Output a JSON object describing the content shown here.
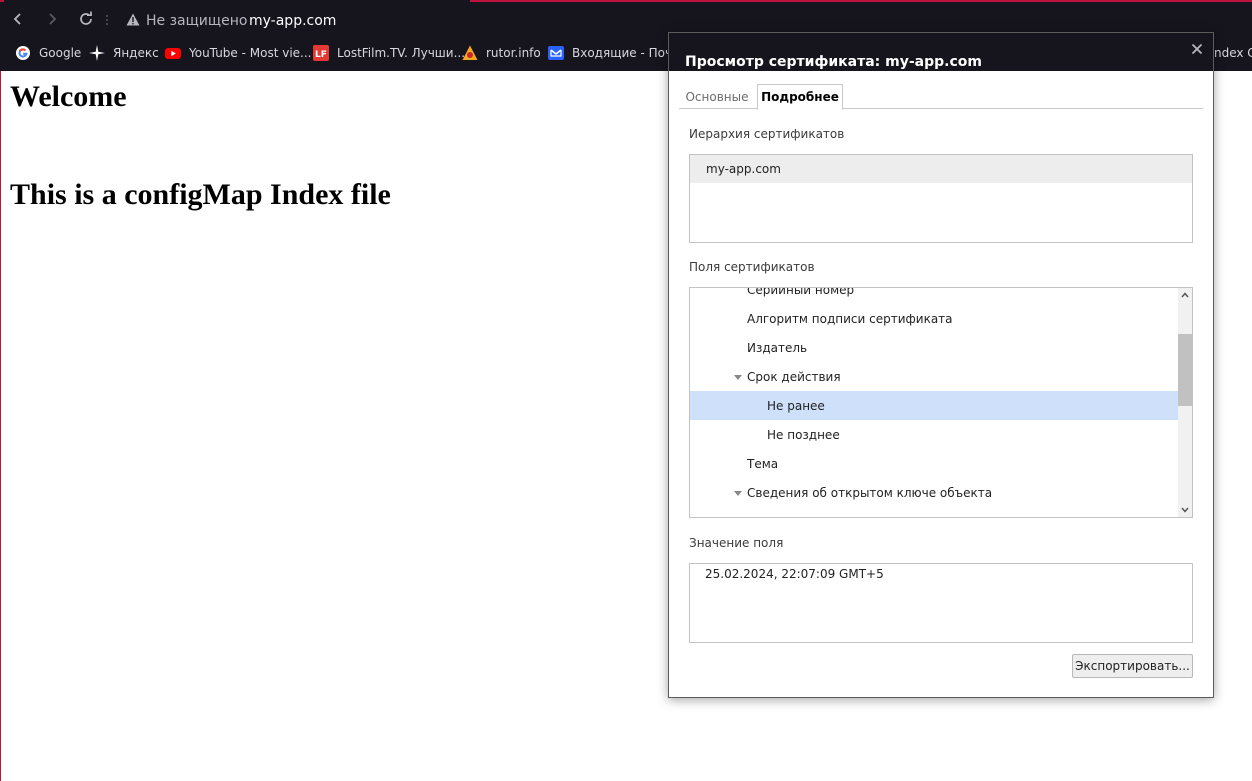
{
  "browser": {
    "security_label": "Не защищено",
    "url": "my-app.com",
    "bookmarks": [
      {
        "label": "Google",
        "icon": "google-icon"
      },
      {
        "label": "Яндекс",
        "icon": "yandex-icon"
      },
      {
        "label": "YouTube - Most vie...",
        "icon": "youtube-icon"
      },
      {
        "label": "LostFilm.TV. Лучши...",
        "icon": "lostfilm-icon"
      },
      {
        "label": "rutor.info",
        "icon": "rutor-icon"
      },
      {
        "label": "Входящие - Почта",
        "icon": "mail-icon"
      }
    ],
    "bookmark_overflow": "ndex C",
    "accent_color": "#c0123e"
  },
  "page": {
    "heading1": "Welcome",
    "heading2": "This is a configMap Index file"
  },
  "dialog": {
    "title": "Просмотр сертификата: my-app.com",
    "tabs": [
      {
        "label": "Основные",
        "active": false
      },
      {
        "label": "Подробнее",
        "active": true
      }
    ],
    "hierarchy_label": "Иерархия сертификатов",
    "hierarchy_items": [
      "my-app.com"
    ],
    "fields_label": "Поля сертификатов",
    "fields": [
      {
        "label": "Серийный номер",
        "level": 2,
        "expanded": null,
        "selected": false
      },
      {
        "label": "Алгоритм подписи сертификата",
        "level": 2,
        "expanded": null,
        "selected": false
      },
      {
        "label": "Издатель",
        "level": 2,
        "expanded": null,
        "selected": false
      },
      {
        "label": "Срок действия",
        "level": 2,
        "expanded": true,
        "selected": false
      },
      {
        "label": "Не ранее",
        "level": 3,
        "expanded": null,
        "selected": true
      },
      {
        "label": "Не позднее",
        "level": 3,
        "expanded": null,
        "selected": false
      },
      {
        "label": "Тема",
        "level": 2,
        "expanded": null,
        "selected": false
      },
      {
        "label": "Сведения об открытом ключе объекта",
        "level": 2,
        "expanded": true,
        "selected": false
      }
    ],
    "value_label": "Значение поля",
    "value": "25.02.2024, 22:07:09 GMT+5",
    "export_label": "Экспортировать...",
    "selection_color": "#cfe0fb"
  }
}
